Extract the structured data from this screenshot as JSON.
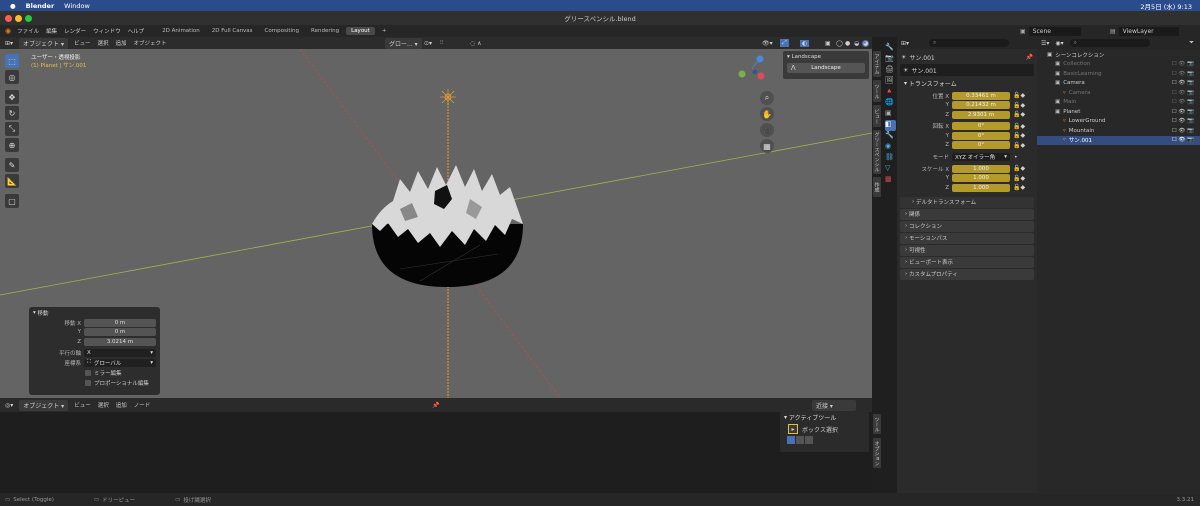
{
  "mac_menu": {
    "app": "Blender",
    "window": "Window",
    "clock": "2月5日 (水)  9:13"
  },
  "title": "グリースペンシル.blend",
  "menus": [
    "ファイル",
    "編集",
    "レンダー",
    "ウィンドウ",
    "ヘルプ"
  ],
  "workspaces": [
    "2D Animation",
    "2D Full Canvas",
    "Compositing",
    "Rendering",
    "Layout"
  ],
  "active_workspace": "Layout",
  "scene": "Scene",
  "view_layer": "ViewLayer",
  "vp_header": {
    "mode": "オブジェクト",
    "view": "ビュー",
    "select": "選択",
    "add": "追加",
    "object": "オブジェクト",
    "orientation": "グロー..."
  },
  "overlay": {
    "view_name": "ユーザー・透視投影",
    "context": "(1) Planet | サン.001"
  },
  "landscape_panel": {
    "title": "Landscape",
    "button": "Landscape"
  },
  "operator_panel": {
    "title": "移動",
    "move_x_label": "移動 X",
    "move_x": "0 m",
    "y_label": "Y",
    "move_y": "0 m",
    "z_label": "Z",
    "move_z": "3.0214 m",
    "constraint_label": "平行の軸",
    "constraint": "X",
    "orient_label": "座標系",
    "orient": "グローバル",
    "mirror": "ミラー編集",
    "proportional": "プロポーショナル編集"
  },
  "props": {
    "search_placeholder": "",
    "object_name": "サン.001",
    "transform_title": "トランスフォーム",
    "loc_label": "位置 X",
    "loc_x": "0.33461 m",
    "loc_y": "0.21432 m",
    "loc_z": "2.9301 m",
    "rot_label": "回転 X",
    "rot_x": "0°",
    "rot_y": "0°",
    "rot_z": "0°",
    "mode_label": "モード",
    "mode": "XYZ オイラー角",
    "scale_label": "スケール X",
    "scale_x": "1.000",
    "scale_y": "1.000",
    "scale_z": "1.000",
    "y": "Y",
    "z": "Z",
    "delta": "デルタトランスフォーム",
    "sections": [
      "関係",
      "コレクション",
      "モーションパス",
      "可視性",
      "ビューポート表示",
      "カスタムプロパティ"
    ]
  },
  "prop_vtabs": [
    "アイテム",
    "ツール",
    "ビュー",
    "グリースペンシル",
    "作成"
  ],
  "outliner": {
    "root": "シーンコレクション",
    "items": [
      {
        "label": "Collection",
        "dim": true,
        "indent": 1
      },
      {
        "label": "BasicLearning",
        "dim": true,
        "indent": 1
      },
      {
        "label": "Camera",
        "dim": false,
        "indent": 1
      },
      {
        "label": "Camera",
        "dim": true,
        "indent": 2
      },
      {
        "label": "Main",
        "dim": true,
        "indent": 1
      },
      {
        "label": "Planet",
        "dim": false,
        "indent": 1
      },
      {
        "label": "LowerGround",
        "dim": false,
        "indent": 2
      },
      {
        "label": "Mountain",
        "dim": false,
        "indent": 2
      },
      {
        "label": "サン.001",
        "dim": false,
        "indent": 2,
        "selected": true
      }
    ]
  },
  "bottom_editor": {
    "mode": "オブジェクト",
    "view": "ビュー",
    "select": "選択",
    "add": "追加",
    "node": "ノード",
    "snap": "近接"
  },
  "tool_panel": {
    "title": "アクティブツール",
    "tool": "ボックス選択"
  },
  "tool_vtabs": [
    "ツール",
    "オプション"
  ],
  "status": {
    "select": "Select (Toggle)",
    "tree": "ドリーピュー",
    "lasso": "投げ縄選択",
    "version": "3.3.21"
  },
  "colors": {
    "accent": "#4772b3",
    "keyed": "#b39a2b",
    "selected_row": "#334d80"
  }
}
